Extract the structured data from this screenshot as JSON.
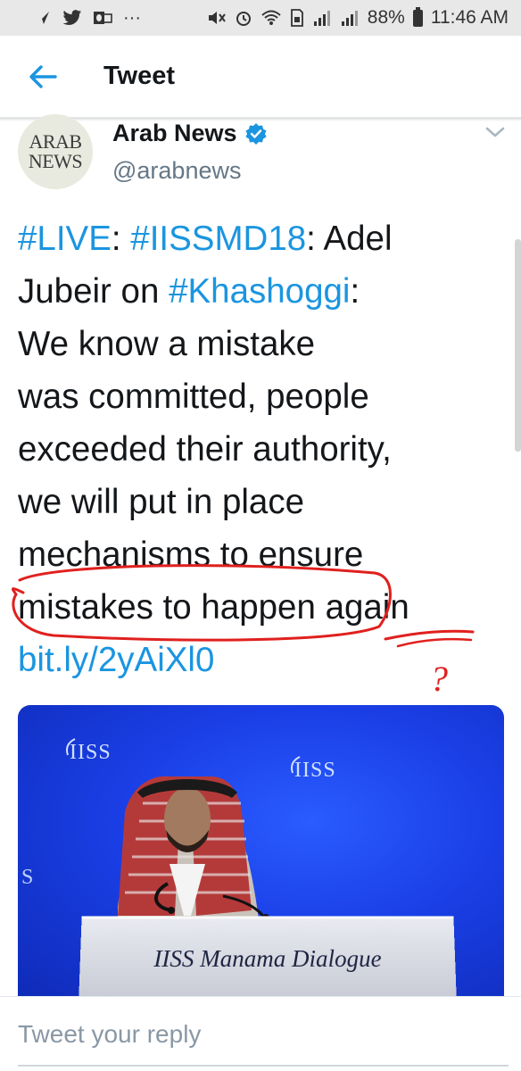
{
  "status_bar": {
    "left_icons": [
      "navigation-icon",
      "twitter-icon",
      "outlook-icon",
      "more-dots-icon"
    ],
    "more_dots": "···",
    "battery": "88%",
    "time": "11:46 AM"
  },
  "header": {
    "title": "Tweet"
  },
  "tweet": {
    "author_name": "Arab News",
    "author_handle": "@arabnews",
    "avatar_line1": "ARAB",
    "avatar_line2": "NEWS",
    "lines": {
      "l1": {
        "tag1": "#LIVE",
        "sep1": ": ",
        "tag2": "#IISSMD18",
        "rest": ": Adel"
      },
      "l2": {
        "pre": "Jubeir on ",
        "tag": "#Khashoggi",
        "rest": ":"
      },
      "l3": "We know a mistake",
      "l4": "was committed, people",
      "l5": "exceeded their authority,",
      "l6": "we will put in place",
      "l7": "mechanisms to ensure",
      "l8": "mistakes to happen again",
      "link": "bit.ly/2yAiXl0"
    },
    "annotation_mark": "?"
  },
  "media": {
    "logo_text": "IISS",
    "side_text": "S",
    "podium_text": "IISS Manama Dialogue"
  },
  "reply": {
    "placeholder": "Tweet your reply"
  },
  "colors": {
    "link": "#1b95e0",
    "text": "#14171a",
    "secondary": "#657786",
    "annotation": "#e0201e",
    "status_bg": "#e8e8e8"
  }
}
